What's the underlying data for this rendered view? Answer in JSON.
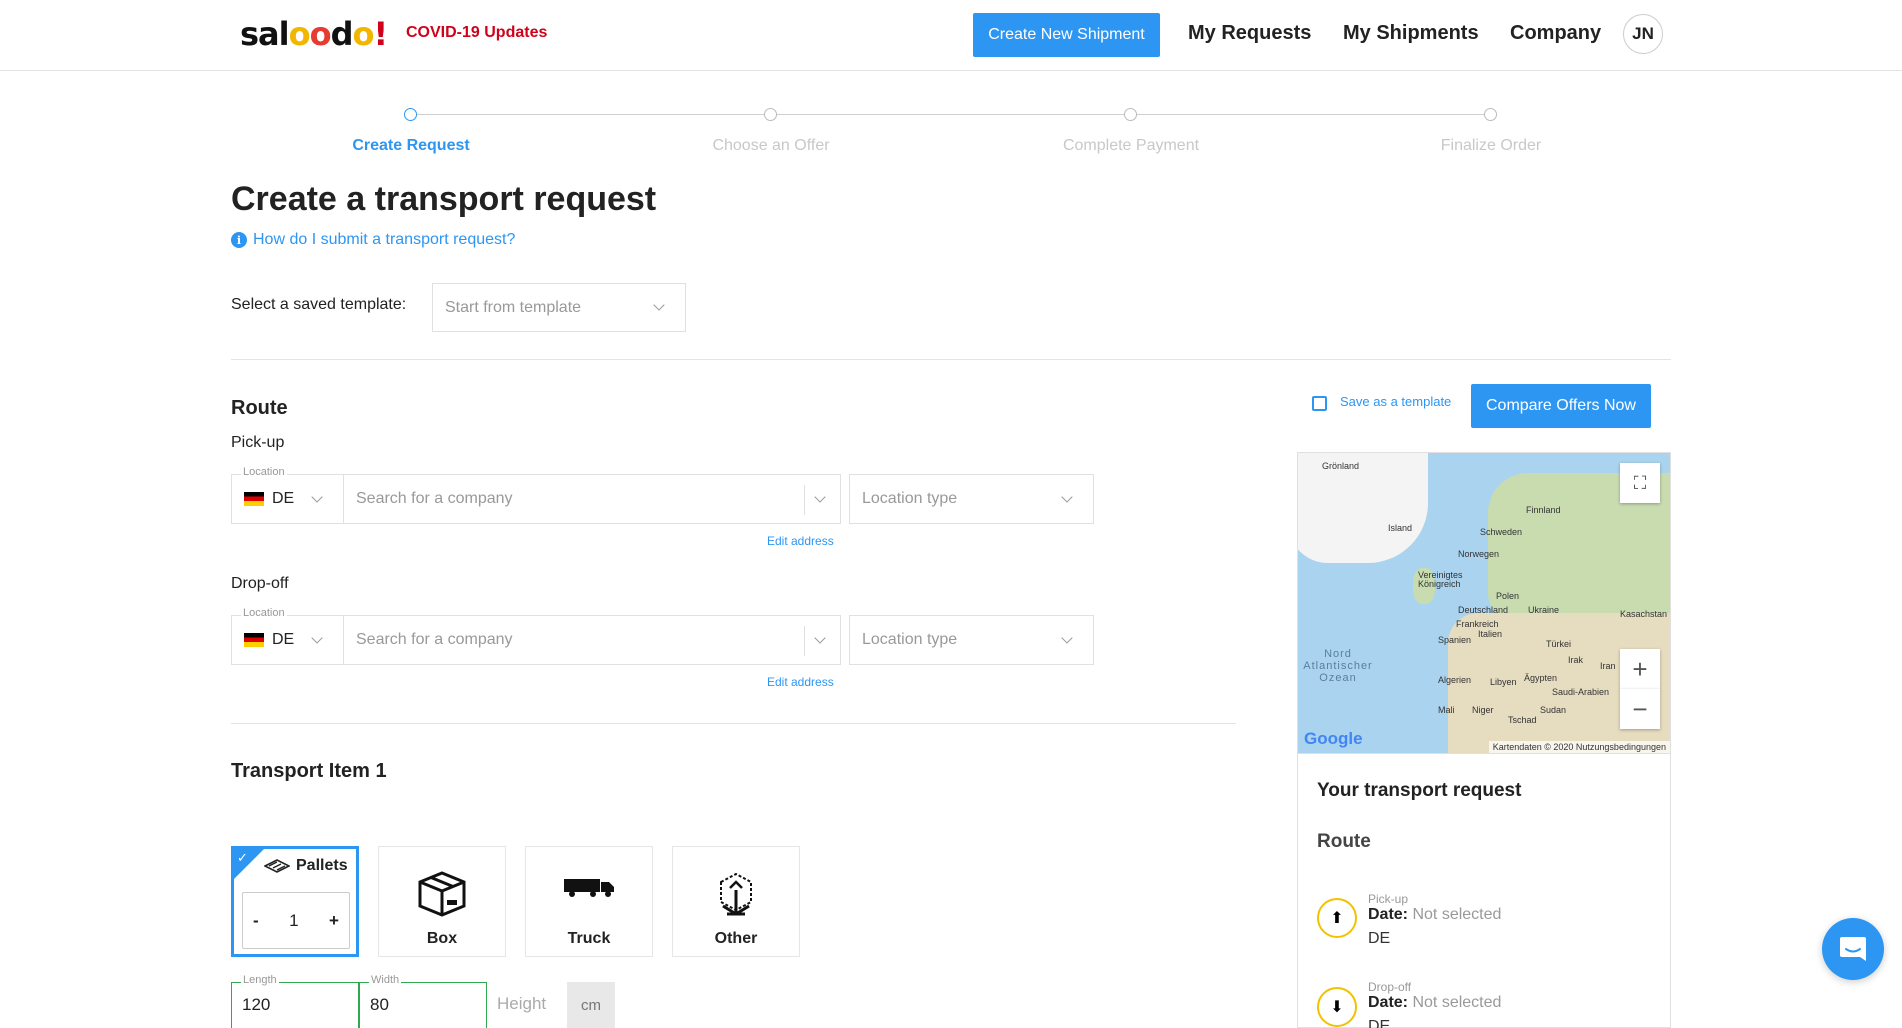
{
  "header": {
    "covid": "COVID-19 Updates",
    "create_shipment": "Create New Shipment",
    "nav": [
      "My Requests",
      "My Shipments",
      "Company"
    ],
    "avatar": "JN"
  },
  "stepper": [
    "Create Request",
    "Choose an Offer",
    "Complete Payment",
    "Finalize Order"
  ],
  "page": {
    "title": "Create a transport request",
    "help": "How do I submit a transport request?",
    "template_label": "Select a saved template:",
    "template_placeholder": "Start from template"
  },
  "route": {
    "title": "Route",
    "pickup": {
      "label": "Pick-up",
      "location_label": "Location",
      "country": "DE",
      "company_placeholder": "Search for a company",
      "location_type_placeholder": "Location type",
      "edit": "Edit address"
    },
    "dropoff": {
      "label": "Drop-off",
      "location_label": "Location",
      "country": "DE",
      "company_placeholder": "Search for a company",
      "location_type_placeholder": "Location type",
      "edit": "Edit address"
    }
  },
  "actions": {
    "save_template": "Save as a template",
    "compare": "Compare Offers Now"
  },
  "map": {
    "labels": [
      "Grönland",
      "Island",
      "Finnland",
      "Schweden",
      "Norwegen",
      "Vereinigtes Königreich",
      "Polen",
      "Deutschland",
      "Ukraine",
      "Frankreich",
      "Kasachstan",
      "Spanien",
      "Italien",
      "Türkei",
      "Irak",
      "Iran",
      "Nord Atlantischer Ozean",
      "Algerien",
      "Libyen",
      "Ägypten",
      "Saudi-Arabien",
      "Mali",
      "Niger",
      "Tschad",
      "Sudan"
    ],
    "google": "Google",
    "footer": "Kartendaten © 2020   Nutzungsbedingungen"
  },
  "summary": {
    "title": "Your transport request",
    "route": "Route",
    "pickup_label": "Pick-up",
    "dropoff_label": "Drop-off",
    "date_key": "Date:",
    "date_value": "Not selected",
    "pickup_country": "DE",
    "dropoff_country": "DE"
  },
  "item": {
    "title": "Transport Item 1",
    "types": [
      "Pallets",
      "Box",
      "Truck",
      "Other"
    ],
    "quantity": "1",
    "minus": "-",
    "plus": "+",
    "length_label": "Length",
    "length": "120",
    "width_label": "Width",
    "width": "80",
    "height_placeholder": "Height",
    "unit": "cm"
  },
  "colors": {
    "accent": "#2d96f3",
    "covid": "#d0021b",
    "pin": "#f2c200",
    "valid": "#2fa84f"
  }
}
